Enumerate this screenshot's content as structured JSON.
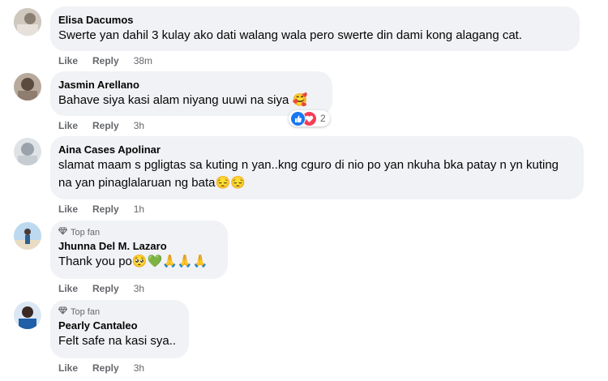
{
  "comments": [
    {
      "name": "Elisa Dacumos",
      "text": "Swerte yan dahil 3 kulay ako dati walang wala pero swerte din dami kong alagang cat.",
      "like": "Like",
      "reply": "Reply",
      "time": "38m"
    },
    {
      "name": "Jasmin Arellano",
      "text": "Bahave siya kasi alam niyang uuwi na siya 🥰",
      "like": "Like",
      "reply": "Reply",
      "time": "3h",
      "reaction_count": "2",
      "reaction_icons": [
        "like-icon",
        "love-icon"
      ]
    },
    {
      "name": "Aina Cases Apolinar",
      "text": "slamat maam s pgligtas sa kuting n yan..kng cguro di nio po yan nkuha bka patay n yn kuting na yan pinaglalaruan ng bata😔😔",
      "like": "Like",
      "reply": "Reply",
      "time": "1h"
    },
    {
      "badge": "Top fan",
      "name": "Jhunna Del M. Lazaro",
      "text": "Thank you po🥺💚🙏🙏🙏",
      "like": "Like",
      "reply": "Reply",
      "time": "3h"
    },
    {
      "badge": "Top fan",
      "name": "Pearly Cantaleo",
      "text": "Felt safe na kasi sya..",
      "like": "Like",
      "reply": "Reply",
      "time": "3h"
    }
  ],
  "colors": {
    "bubble": "#f0f2f5",
    "secondary_text": "#65676b",
    "like_blue": "#1877f2",
    "love_red": "#f33e58"
  }
}
